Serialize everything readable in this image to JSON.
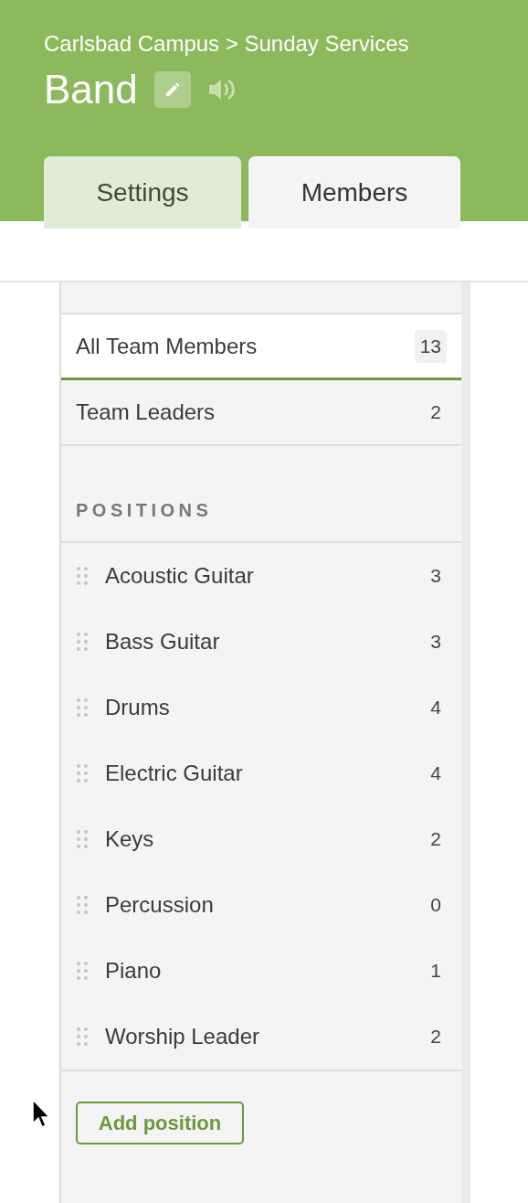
{
  "header": {
    "breadcrumb": "Carlsbad Campus > Sunday Services",
    "title": "Band"
  },
  "tabs": [
    {
      "label": "Settings",
      "selected": false
    },
    {
      "label": "Members",
      "selected": true
    }
  ],
  "filters": [
    {
      "label": "All Team Members",
      "count": "13",
      "selected": true
    },
    {
      "label": "Team Leaders",
      "count": "2",
      "selected": false
    }
  ],
  "positions_heading": "POSITIONS",
  "positions": [
    {
      "name": "Acoustic Guitar",
      "count": "3"
    },
    {
      "name": "Bass Guitar",
      "count": "3"
    },
    {
      "name": "Drums",
      "count": "4"
    },
    {
      "name": "Electric Guitar",
      "count": "4"
    },
    {
      "name": "Keys",
      "count": "2"
    },
    {
      "name": "Percussion",
      "count": "0"
    },
    {
      "name": "Piano",
      "count": "1"
    },
    {
      "name": "Worship Leader",
      "count": "2"
    }
  ],
  "add_button": "Add position"
}
